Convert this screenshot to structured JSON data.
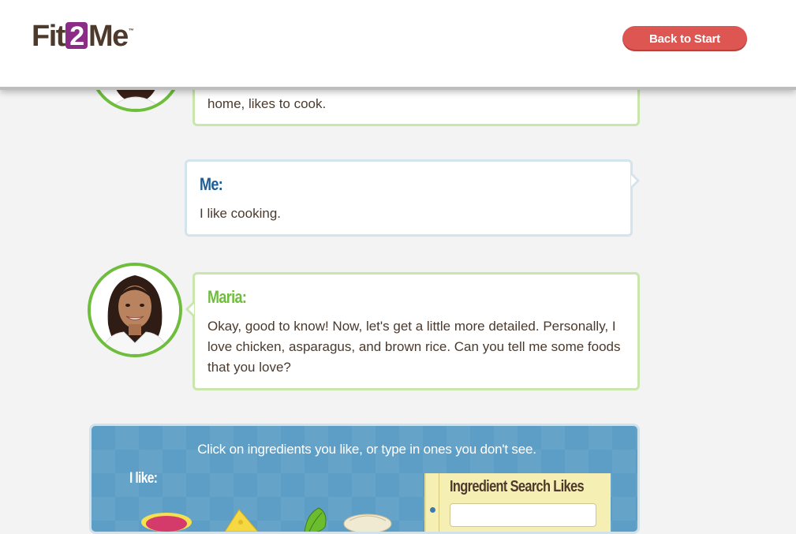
{
  "header": {
    "logo": {
      "part1": "Fit",
      "part2": "2",
      "part3": "Me",
      "trademark": "™"
    },
    "back_button": "Back to Start"
  },
  "colors": {
    "maria_green": "#6fbd3c",
    "me_blue": "#1d5c95",
    "back_button_red": "#de5652",
    "panel_blue": "#5d9ec6",
    "notepad_yellow": "#f6efb4",
    "logo_purple": "#8b2d86",
    "logo_brown": "#4e3a2c"
  },
  "chat": {
    "messages": [
      {
        "speaker": "",
        "text": "home, likes to cook."
      },
      {
        "speaker": "Me:",
        "text": "I like cooking."
      },
      {
        "speaker": "Maria:",
        "text": "Okay, good to know! Now, let's get a little more detailed. Personally, I love chicken, asparagus, and brown rice. Can you tell me some foods that you love?"
      }
    ]
  },
  "ingredients_panel": {
    "instruction": "Click on ingredients you like, or type in ones you don't see.",
    "i_like_label": "I like:",
    "search_title": "Ingredient Search Likes",
    "search_value": "",
    "items": [
      {
        "icon": "meat-icon"
      },
      {
        "icon": "cheese-icon"
      },
      {
        "icon": "vegetable-icon"
      },
      {
        "icon": "grain-icon"
      }
    ]
  }
}
